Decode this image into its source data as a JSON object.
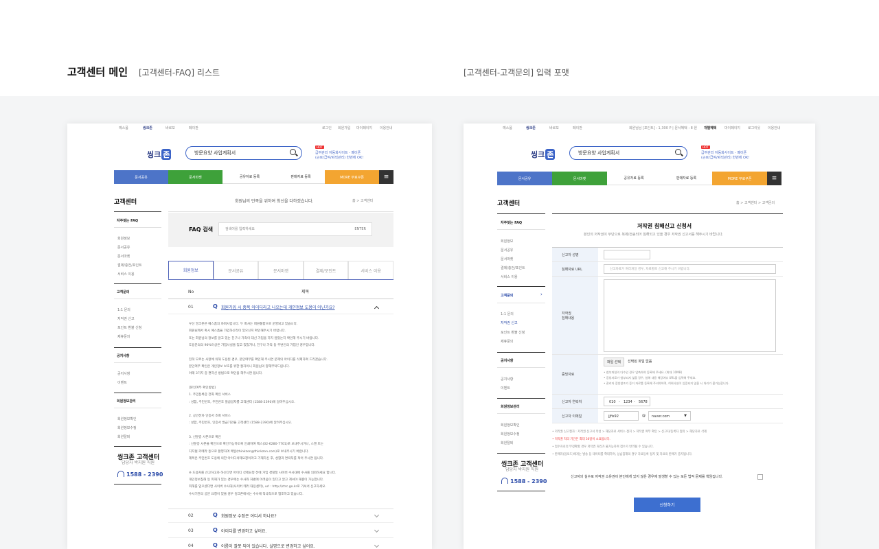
{
  "captions": {
    "main": "고객센터 메인",
    "faq_list": "[고객센터-FAQ] 리스트",
    "inquiry_form": "[고객센터-고객문의] 입력 포맷"
  },
  "site": {
    "topbar_brands": [
      "예스폼",
      "씽크존",
      "바로보",
      "페이판"
    ],
    "util_links_left": [
      "로그인",
      "회원가입",
      "마이페이지",
      "이용안내"
    ],
    "util_links_right": [
      "회원님님 [포인트] : 1,300 P | 문서혜택 : 8 원",
      "개별혜택",
      "마이페이지",
      "로그아웃",
      "이용안내"
    ],
    "logo_text": "씽크",
    "logo_badge": "존",
    "search_value": "방문요양 사업계획서",
    "hot_badge": "HOT",
    "promo_line1": "급여관리 자동화사이트 - 페이폰",
    "promo_line2": "(근로/급여/퇴직관리) 한번에 OK!",
    "nav": [
      "문서공유",
      "문서마켓",
      "공유자료 등록",
      "판매자료 등록",
      "MORE 무료쿠폰",
      "≡"
    ],
    "nav_colors": [
      "#4d74c8",
      "#3ea13a",
      "#ffffff",
      "#ffffff",
      "#f3a531",
      "#333333"
    ]
  },
  "sidebar": {
    "title": "고객센터",
    "section1": "자주찾는 FAQ",
    "faq_items": [
      "회원정보",
      "문서공유",
      "문서마켓",
      "결제/충전/포인트",
      "서비스 이용"
    ],
    "section2": "고객문의",
    "inquiry_items": [
      "1:1 문의",
      "저작권 신고",
      "포인트 환불 신청",
      "제휴문의"
    ],
    "section3": "공지사항",
    "notice_items": [
      "공지사항",
      "이벤트"
    ],
    "section4": "회원정보관리",
    "member_items": [
      "회원정보확인",
      "회원정보수정",
      "회원탈퇴"
    ],
    "contact_title": "씽크존 고객센터",
    "contact_sub": "담당자 박지원 직원",
    "phone": "1588 - 2390"
  },
  "faq_page": {
    "headline": "회원님의 만족을 위하여 최선을 다하겠습니다.",
    "breadcrumb": "홈 > 고객센터",
    "search_label": "FAQ 검색",
    "search_placeholder": "검색어를 입력하세요",
    "search_button": "ENTER",
    "tabs": [
      "회원정보",
      "문서공유",
      "문서마켓",
      "결제/포인트",
      "서비스 이용"
    ],
    "col_no": "No",
    "col_title": "제목",
    "rows": [
      {
        "no": "01",
        "title": "회원가입 시 중복 아이디라고 나오는데 개인정보 도용이 아닌가요?"
      },
      {
        "no": "02",
        "title": "회원정보 수정은 어디서 하나요?"
      },
      {
        "no": "03",
        "title": "아이디를 변경하고 싶어요."
      },
      {
        "no": "04",
        "title": "이름이 잘못 되어 있습니다. 실명으로 변경하고 싶어요."
      }
    ],
    "answer_lines": [
      "우선 씽크존은 예스폼의 자회사입니다. 두 회사는 회원통합으로 운영되고 있습니다.",
      "회원님께서 혹시 예스폼을 가입하신적이 있으신지 확인해주시기 바랍니다.",
      "또는 회원님의 정보를 알고 있는 친구나 가족이 대신 가입을 하지 않았는지 확인해 주시기 바랍니다.",
      "도용문의의 90%이상은 가입사실을 잊고 있었거나, 친구나 가족 등 주변인의 가입인 경우입니다.",
      "",
      "전혀 모르는 사항에 의해 도용된 경우, 본인여부를 확인해 주시면 문제의 아이디를 삭제하여 드리겠습니다.",
      "본인여부 확인은 개인정보 보호를 위한 절차이니 회원님의 양해부탁드립니다.",
      "아래 3가지 중 편하신 방법으로 확인을 해주시면 됩니다.",
      "",
      "[본인여부 확인방법]",
      "1. 주민등록증 전화 확인 서비스",
      ": 성함, 주민번호, 주민번호 발급일자를 고객센터 (1588-2390)에 알려주십시오.",
      "",
      "2. 공인전자 인증서 조회 서비스",
      ": 성함, 주민번호, 인증서 발급기관을 고객센터 (1588-2390)에 알려주십시오.",
      "",
      "3. 신분증 사본으로 확인",
      ": 신분증 사본을 확인으로 확인가능하도록 인쇄하여 팩스(02-6280-7701)로 보내주시거나, 스캔 또는",
      "디지털 카메라 등으로 촬영하여 메일(thinkzon@thinkzon.com)로 보내주시기 바랍니다.",
      "제목은 주민번호 도용에 의한 아이디삭제요청이라고 기재하신 후, 성함과 연락처를 적어 주시면 됩니다.",
      "",
      "※ 도용자를 신고하고자 하신다면 아이디 삭제요청 전에 가입 경찰청 사이버 수사대에 수사를 의뢰하세요 합니다.",
      "개인정보침해 등 피해가 있는 경우에는 수사와 처벌에 어려움이 있다고 알고 계셔야 해결이 가능합니다.",
      "피해를 입으셨다면 사이버 수사대(사이버 테러 대응센터), url : http://ctrc.go.kr로 가셔서 신고하세요.",
      "수사기관의 공문 요청이 있을 경우 씽크존에서는 수사에 적극적으로 협조하고 있습니다."
    ]
  },
  "form_page": {
    "breadcrumb": "홈 > 고객센터 > 고객문의",
    "title": "저작권 침해신고 신청서",
    "subtitle": "본인의 저작권이 무단으로 복제/전송되어 침해되고 있을 경우 저작권 신고서를 해주시기 바랍니다.",
    "labels": [
      "신고자 성명",
      "침해자료 URL",
      "저작권\n침해내용",
      "증빙자료",
      "신고자 연락처",
      "신고자 이메일"
    ],
    "url_placeholder": "신고자료가 여러개일 경우, 자료별로 신고해 주시기 바랍니다.",
    "file_button": "파일 선택",
    "file_status": "선택된 파일 없음",
    "file_notes": [
      "• 첨부파일의 다수인 경우 압축하여 등록해 주세요. (최대 10MB)",
      "• 증빙자료가 첨부되지 않을 경우, 침해 내용 해당여부 URL을 입력해 주세요.",
      "• 관리자 증빙참조가 증거 자료를 등록해 주셔야하며, 허위사실이 입증되지 않을 시 처리가 불가능합니다."
    ],
    "phone_parts": [
      "010",
      "1234",
      "5678"
    ],
    "email_id": "jjfis92",
    "email_domain": "naver.com",
    "notes": [
      "• 저작권 신고절차 : 저작권 신고서 작성 > 해당자료 서비스 정지 > 저작권 여부 확인 > 신고자/등록자 협의 > 해당자료 삭제",
      "• 저작권 처리 기간은 최대 30일이 소요됩니다.",
      "• 접수자료의 부정확할 경우 저작권 처리가 불가능하며 접수가 반려될 수 있습니다.",
      "• 판매자(업로드)에게는 발송 등 데이터를 확대하여, 상습침해의 경우 자료등록 정지 및 자료의 판매가 중지됩니다."
    ],
    "agree_text": "신고자의 실수로 저작권 소유권이 본인에게 있지 않은 경우에 발생할 수 있는 모든 법적 문제를 책임집니다.",
    "submit": "신청하기"
  }
}
